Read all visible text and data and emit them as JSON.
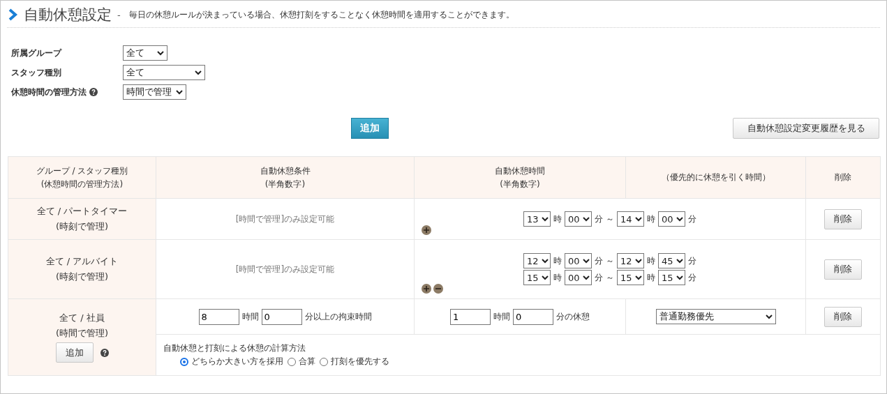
{
  "header": {
    "title": "自動休憩設定",
    "separator": "-",
    "description": "毎日の休憩ルールが決まっている場合、休憩打刻をすることなく休憩時間を適用することができます。"
  },
  "filters": [
    {
      "label": "所属グループ",
      "value": "全て",
      "help": false
    },
    {
      "label": "スタッフ種別",
      "value": "全て",
      "help": false
    },
    {
      "label": "休憩時間の管理方法",
      "value": "時間で管理",
      "help": true
    }
  ],
  "add_button": "追加",
  "history_button": "自動休憩設定変更履歴を見る",
  "table": {
    "columns": [
      {
        "title": "グループ / スタッフ種別",
        "note": "(休憩時間の管理方法)"
      },
      {
        "title": "自動休憩条件",
        "note": "(半角数字)"
      },
      {
        "title": "自動休憩時間",
        "note": "(半角数字)"
      },
      {
        "title": "（優先的に休憩を引く時間）"
      },
      {
        "title": "削除"
      }
    ],
    "rows": [
      {
        "kind": "time_of_day",
        "group": "全て / パートタイマー",
        "method": "(時刻で管理)",
        "condition_note": "[時間で管理]のみ設定可能",
        "add_icon": true,
        "remove_icon": false,
        "delete_button": "削除",
        "ranges": [
          [
            {
              "kind": "select",
              "value": "13"
            },
            {
              "kind": "label",
              "text": "時"
            },
            {
              "kind": "select",
              "value": "00"
            },
            {
              "kind": "label",
              "text": "分"
            },
            {
              "kind": "label",
              "text": "～"
            },
            {
              "kind": "select",
              "value": "14"
            },
            {
              "kind": "label",
              "text": "時"
            },
            {
              "kind": "select",
              "value": "00"
            },
            {
              "kind": "label",
              "text": "分"
            }
          ]
        ]
      },
      {
        "kind": "time_of_day",
        "group": "全て / アルバイト",
        "method": "(時刻で管理)",
        "condition_note": "[時間で管理]のみ設定可能",
        "add_icon": true,
        "remove_icon": true,
        "delete_button": "削除",
        "ranges": [
          [
            {
              "kind": "select",
              "value": "12"
            },
            {
              "kind": "label",
              "text": "時"
            },
            {
              "kind": "select",
              "value": "00"
            },
            {
              "kind": "label",
              "text": "分"
            },
            {
              "kind": "label",
              "text": "～"
            },
            {
              "kind": "select",
              "value": "12"
            },
            {
              "kind": "label",
              "text": "時"
            },
            {
              "kind": "select",
              "value": "45"
            },
            {
              "kind": "label",
              "text": "分"
            }
          ],
          [
            {
              "kind": "select",
              "value": "15"
            },
            {
              "kind": "label",
              "text": "時"
            },
            {
              "kind": "select",
              "value": "00"
            },
            {
              "kind": "label",
              "text": "分"
            },
            {
              "kind": "label",
              "text": "～"
            },
            {
              "kind": "select",
              "value": "15"
            },
            {
              "kind": "label",
              "text": "時"
            },
            {
              "kind": "select",
              "value": "15"
            },
            {
              "kind": "label",
              "text": "分"
            }
          ]
        ]
      },
      {
        "kind": "duration",
        "group": "全て / 社員",
        "method": "(時間で管理)",
        "add_button": "追加",
        "help": true,
        "delete_button": "削除",
        "condition": [
          {
            "kind": "input",
            "value": "8"
          },
          {
            "kind": "label",
            "text": "時間"
          },
          {
            "kind": "input",
            "value": "0"
          },
          {
            "kind": "label",
            "text": "分以上の拘束時間"
          }
        ],
        "break": [
          {
            "kind": "input",
            "value": "1"
          },
          {
            "kind": "label",
            "text": "時間"
          },
          {
            "kind": "input",
            "value": "0"
          },
          {
            "kind": "label",
            "text": "分の休憩"
          }
        ],
        "priority": "普通勤務優先",
        "calculation": {
          "title": "自動休憩と打刻による休憩の計算方法",
          "options": [
            {
              "label": "どちらか大きい方を採用",
              "selected": true
            },
            {
              "label": "合算",
              "selected": false
            },
            {
              "label": "打刻を優先する",
              "selected": false
            }
          ]
        }
      }
    ]
  }
}
